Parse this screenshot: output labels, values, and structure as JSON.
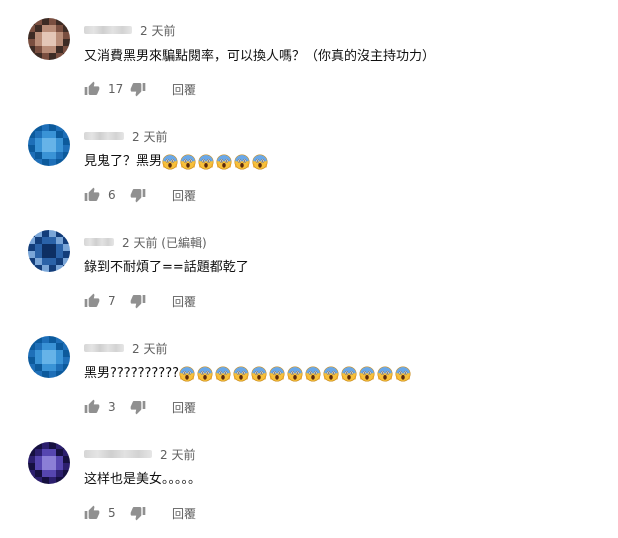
{
  "reply_label": "回覆",
  "comments": [
    {
      "time": "2 天前",
      "text": "又消費黑男來騙點閱率，可以換人嗎？（你真的沒主持功力）",
      "likes": "17",
      "emoji_count": 0,
      "avatar_colors": [
        "#3d2b24",
        "#b98d78",
        "#7a4f40",
        "#e4c7b7"
      ]
    },
    {
      "time": "2 天前",
      "text": "見鬼了？黑男",
      "likes": "6",
      "emoji_count": 6,
      "avatar_colors": [
        "#1e6fb8",
        "#3a93d6",
        "#0c5a9c",
        "#66b3e8"
      ]
    },
    {
      "time": "2 天前 (已編輯)",
      "text": "錄到不耐煩了==話題都乾了",
      "likes": "7",
      "emoji_count": 0,
      "avatar_colors": [
        "#123d7a",
        "#2a62a8",
        "#7aa6d8",
        "#0d2f63"
      ]
    },
    {
      "time": "2 天前",
      "text": "黑男??????????",
      "likes": "3",
      "emoji_count": 13,
      "avatar_colors": [
        "#1e6fb8",
        "#3a93d6",
        "#0c5a9c",
        "#66b3e8"
      ]
    },
    {
      "time": "2 天前",
      "text": "这样也是美女。。。。。",
      "likes": "5",
      "emoji_count": 0,
      "avatar_colors": [
        "#2c1f6e",
        "#5646b0",
        "#161040",
        "#8b7fd6"
      ]
    }
  ],
  "icons": {
    "like": "thumb-up-icon",
    "dislike": "thumb-down-icon",
    "emoji": "face-screaming-in-fear-emoji"
  }
}
